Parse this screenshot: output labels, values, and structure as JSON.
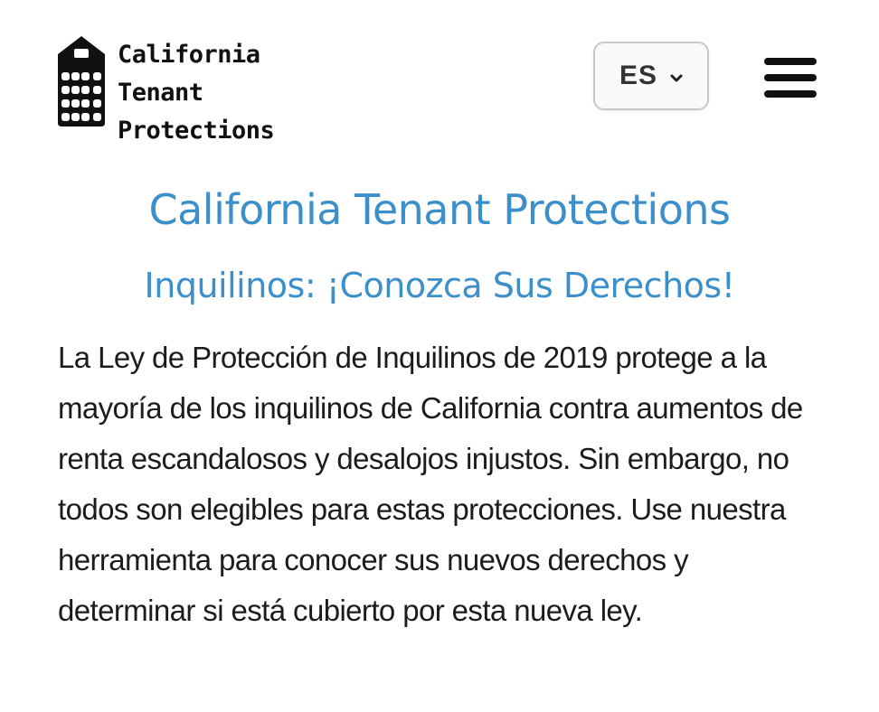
{
  "header": {
    "logo": {
      "icon": "building-icon",
      "lines": [
        "California",
        "Tenant",
        "Protections"
      ]
    },
    "language": {
      "selected": "ES",
      "icon": "chevron-down-icon"
    },
    "menu": {
      "icon": "hamburger-menu-icon"
    }
  },
  "main": {
    "title": "California Tenant Protections",
    "subtitle": "Inquilinos: ¡Conozca Sus Derechos!",
    "intro": "La Ley de Protección de Inquilinos de 2019 protege a la mayoría de los inquilinos de California contra aumentos de renta escandalosos y desalojos injustos. Sin embargo, no todos son elegibles para estas protecciones. Use nuestra herramienta para conocer sus nuevos derechos y determinar si está cubierto por esta nueva ley."
  },
  "colors": {
    "accent": "#3b8fcb",
    "text": "#1c1c1c",
    "logo": "#111111"
  }
}
